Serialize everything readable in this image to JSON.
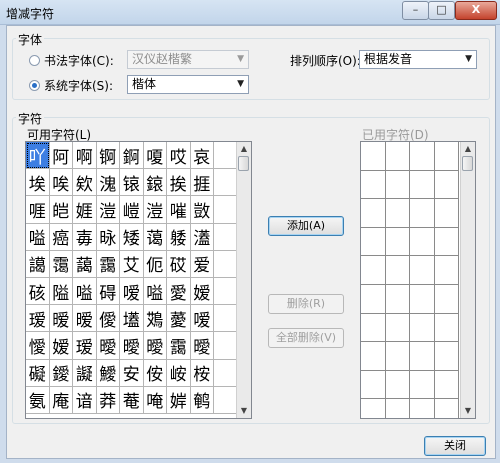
{
  "window": {
    "title": "增减字符",
    "min_label": "–",
    "max_label": "□",
    "close_label": "X"
  },
  "font_group": {
    "title": "字体",
    "calligraphy_label": "书法字体(C):",
    "calligraphy_value": "汉仪赵楷繁",
    "system_label": "系统字体(S):",
    "system_value": "楷体",
    "sort_label": "排列顺序(O):",
    "sort_value": "根据发音"
  },
  "chars_group": {
    "title": "字符",
    "available_label": "可用字符(L)",
    "used_label": "已用字符(D)",
    "available_chars": [
      "吖",
      "阿",
      "啊",
      "锕",
      "錒",
      "嗄",
      "哎",
      "哀",
      "埃",
      "唉",
      "欸",
      "溾",
      "锿",
      "鎄",
      "挨",
      "捱",
      "啀",
      "皑",
      "娾",
      "溰",
      "嵦",
      "溰",
      "嗺",
      "敳",
      "嗌",
      "癌",
      "毐",
      "昹",
      "矮",
      "蔼",
      "躷",
      "濭",
      "譪",
      "霭",
      "藹",
      "靄",
      "艾",
      "伌",
      "砹",
      "爱",
      "硋",
      "隘",
      "嗌",
      "碍",
      "嗳",
      "嗌",
      "愛",
      "嫒",
      "瑷",
      "暧",
      "暧",
      "僾",
      "壒",
      "鴱",
      "薆",
      "嗳",
      "懓",
      "嫒",
      "瑷",
      "曖",
      "曖",
      "曖",
      "靄",
      "曖",
      "礙",
      "鑀",
      "譺",
      "鱫",
      "安",
      "侒",
      "峖",
      "桉",
      "氨",
      "庵",
      "谙",
      "莽",
      "菴",
      "唵",
      "婩",
      "鹌"
    ]
  },
  "buttons": {
    "add": "添加(A)",
    "delete": "删除(R)",
    "delete_all": "全部删除(V)",
    "close": "关闭"
  },
  "icons": {
    "radio": "radio-icon",
    "dropdown": "chevron-down-icon",
    "scroll_up": "scroll-up-icon",
    "scroll_down": "scroll-down-icon"
  }
}
